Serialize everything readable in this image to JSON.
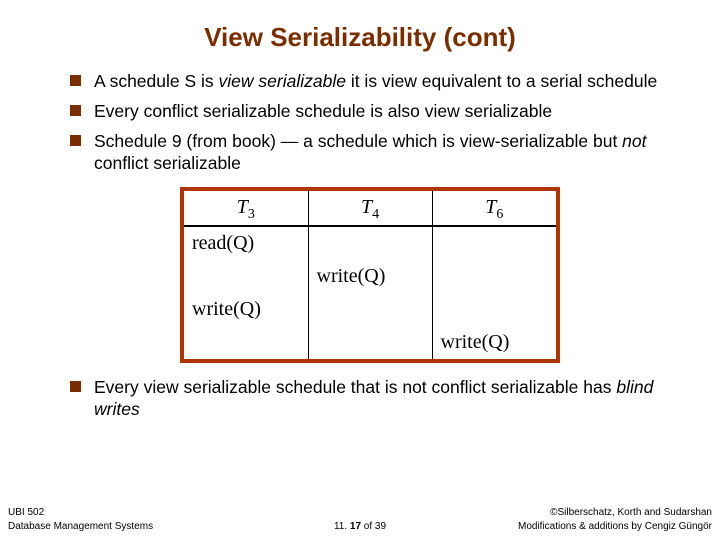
{
  "title": "View Serializability (cont)",
  "bullets": {
    "b1_pre": "A schedule S is ",
    "b1_em": "view serializable",
    "b1_post": " it is view equivalent to a serial schedule",
    "b2": "Every conflict serializable schedule is also view serializable",
    "b3_pre": "Schedule 9 (from book) — a schedule which is view-serializable but ",
    "b3_em": "not",
    "b3_post": " conflict serializable",
    "b4_pre": "Every view serializable schedule that is not conflict serializable has ",
    "b4_em": "blind writes"
  },
  "table": {
    "h1_base": "T",
    "h1_sub": "3",
    "h2_base": "T",
    "h2_sub": "4",
    "h3_base": "T",
    "h3_sub": "6",
    "r1c1": "read(Q)",
    "r1c2": "",
    "r1c3": "",
    "r2c1": "",
    "r2c2": "write(Q)",
    "r2c3": "",
    "r3c1": "write(Q)",
    "r3c2": "",
    "r3c3": "",
    "r4c1": "",
    "r4c2": "",
    "r4c3": "write(Q)"
  },
  "footer": {
    "left_top": "UBI 502",
    "left_bot": "Database Management Systems",
    "center_pre": "11. ",
    "center_bold": "17",
    "center_post": " of 39",
    "right_top": "©Silberschatz, Korth and Sudarshan",
    "right_bot": "Modifications & additions by Cengiz Güngör"
  }
}
